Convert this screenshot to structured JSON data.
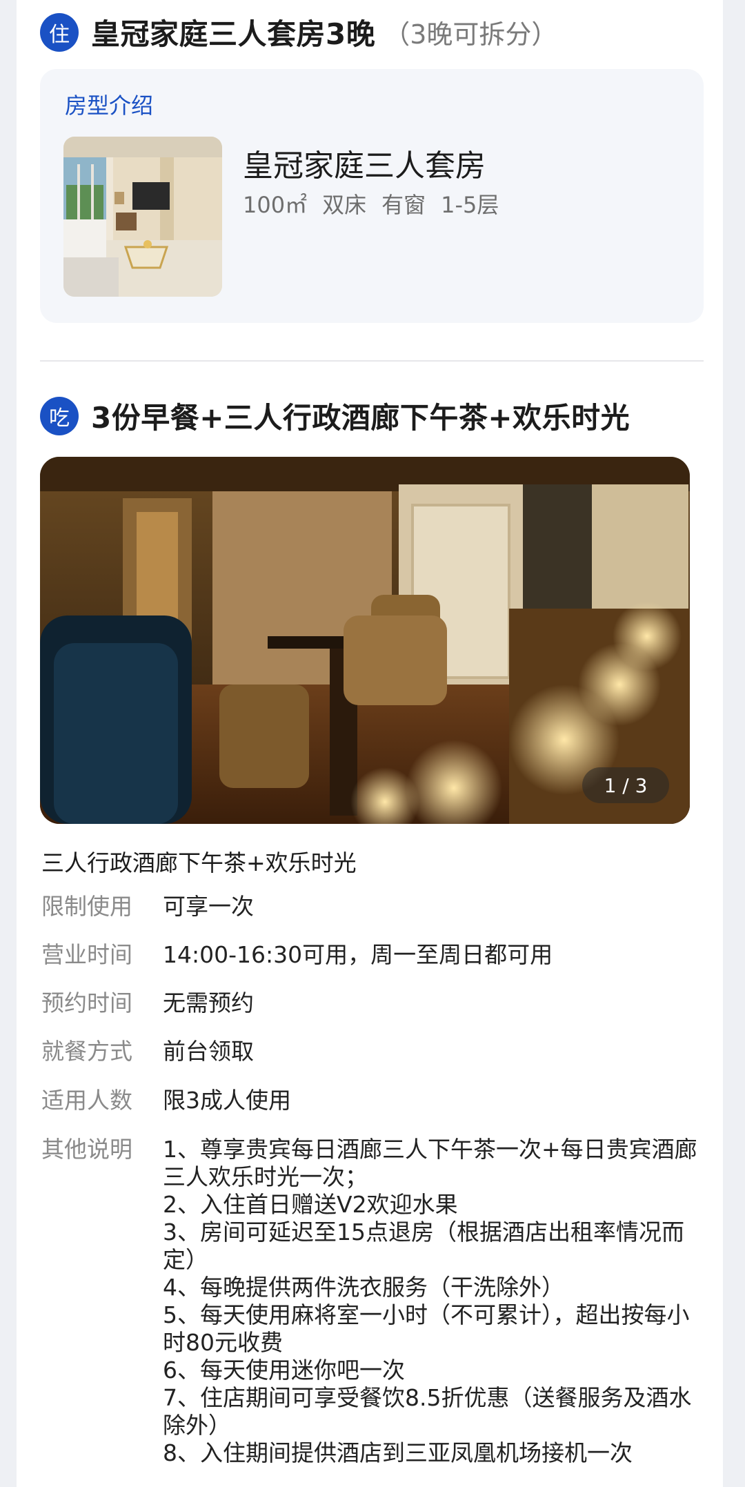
{
  "stay": {
    "badge": "住",
    "title": "皇冠家庭三人套房3晚",
    "note": "（3晚可拆分）"
  },
  "room_card": {
    "label": "房型介绍",
    "name": "皇冠家庭三人套房",
    "specs": [
      "100㎡",
      "双床",
      "有窗",
      "1-5层"
    ]
  },
  "dining": {
    "badge": "吃",
    "title": "3份早餐+三人行政酒廊下午茶+欢乐时光",
    "image_counter": "1 / 3"
  },
  "detail": {
    "title": "三人行政酒廊下午茶+欢乐时光",
    "rows": [
      {
        "label": "限制使用",
        "value": "可享一次"
      },
      {
        "label": "营业时间",
        "value": "14:00-16:30可用，周一至周日都可用"
      },
      {
        "label": "预约时间",
        "value": "无需预约"
      },
      {
        "label": "就餐方式",
        "value": "前台领取"
      },
      {
        "label": "适用人数",
        "value": "限3成人使用"
      }
    ],
    "notes_label": "其他说明",
    "notes": [
      "1、尊享贵宾每日酒廊三人下午茶一次+每日贵宾酒廊三人欢乐时光一次；",
      "2、入住首日赠送V2欢迎水果",
      "3、房间可延迟至15点退房（根据酒店出租率情况而定）",
      "4、每晚提供两件洗衣服务（干洗除外）",
      "5、每天使用麻将室一小时（不可累计），超出按每小时80元收费",
      "6、每天使用迷你吧一次",
      "7、住店期间可享受餐饮8.5折优惠（送餐服务及酒水除外）",
      "8、入住期间提供酒店到三亚凤凰机场接机一次"
    ]
  },
  "colors": {
    "accent": "#1a51c4",
    "card_bg": "#f4f6fa",
    "muted": "#8a8a8a"
  }
}
